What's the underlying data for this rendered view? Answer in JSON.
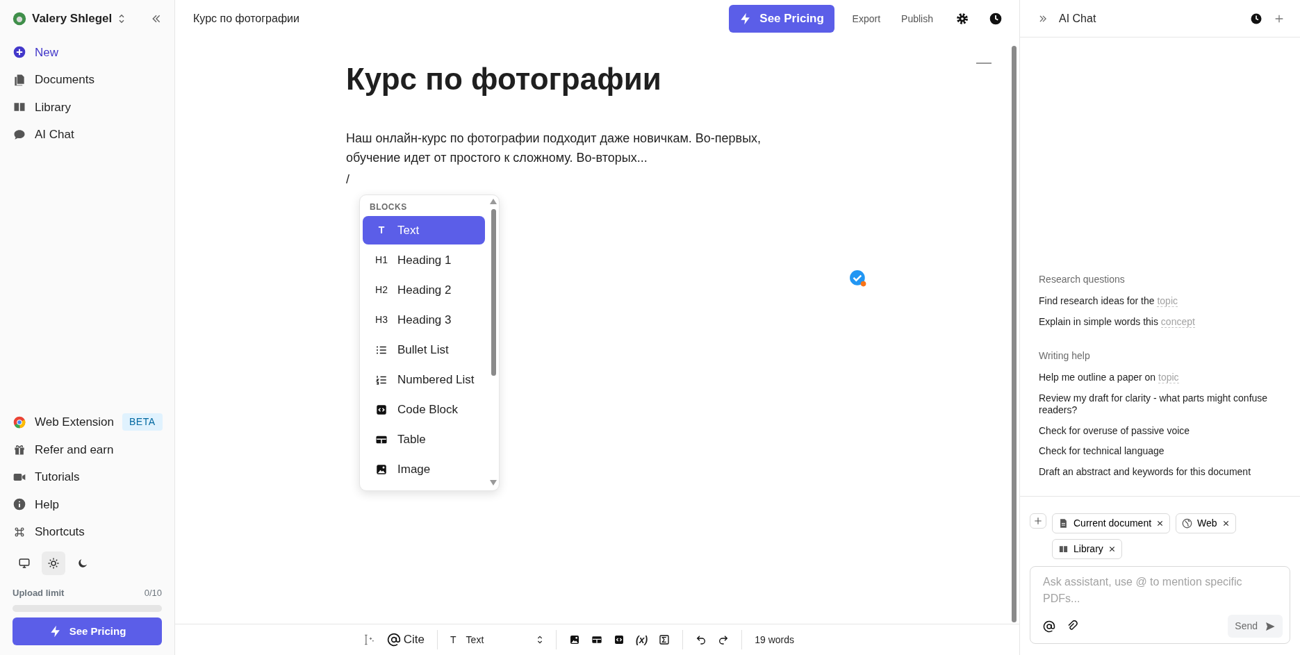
{
  "sidebar": {
    "user": {
      "name": "Valery Shlegel"
    },
    "nav": [
      {
        "kind": "new",
        "label": "New"
      },
      {
        "kind": "documents",
        "label": "Documents"
      },
      {
        "kind": "library",
        "label": "Library"
      },
      {
        "kind": "chat",
        "label": "AI Chat"
      }
    ],
    "bottom_nav": [
      {
        "kind": "extension",
        "label": "Web Extension",
        "badge": "BETA"
      },
      {
        "kind": "gift",
        "label": "Refer and earn"
      },
      {
        "kind": "video",
        "label": "Tutorials"
      },
      {
        "kind": "info",
        "label": "Help"
      },
      {
        "kind": "command",
        "label": "Shortcuts"
      }
    ],
    "themes": [
      {
        "kind": "system",
        "selected": false
      },
      {
        "kind": "light",
        "selected": true
      },
      {
        "kind": "dark",
        "selected": false
      }
    ],
    "upload": {
      "label": "Upload limit",
      "count": "0/10",
      "level": 0
    },
    "pricing_button": "See Pricing"
  },
  "topbar": {
    "doc_title": "Курс по фотографии",
    "pricing_button": "See Pricing",
    "actions": [
      "Export",
      "Publish"
    ]
  },
  "editor": {
    "title": "Курс по фотографии",
    "paragraph": "Наш онлайн-курс по фотографии подходит даже новичкам. Во-первых, обучение идет от простого к сложному. Во-вторых...",
    "slash": "/",
    "menu": {
      "heading": "BLOCKS",
      "items": [
        {
          "kind": "glyph",
          "glyph": "T",
          "label": "Text",
          "selected": true
        },
        {
          "kind": "glyph",
          "glyph": "H1",
          "label": "Heading 1",
          "selected": false
        },
        {
          "kind": "glyph",
          "glyph": "H2",
          "label": "Heading 2",
          "selected": false
        },
        {
          "kind": "glyph",
          "glyph": "H3",
          "label": "Heading 3",
          "selected": false
        },
        {
          "kind": "bullet",
          "label": "Bullet List",
          "selected": false
        },
        {
          "kind": "numbered",
          "label": "Numbered List",
          "selected": false
        },
        {
          "kind": "code",
          "label": "Code Block",
          "selected": false
        },
        {
          "kind": "table",
          "label": "Table",
          "selected": false
        },
        {
          "kind": "image",
          "label": "Image",
          "selected": false
        }
      ]
    }
  },
  "toolbar": {
    "cite": "Cite",
    "block_glyph": "T",
    "block_type": "Text",
    "variable_glyph": "(x)",
    "word_count": "19 words"
  },
  "chat": {
    "title": "AI Chat",
    "sections": [
      {
        "title": "Research questions",
        "prompts": [
          {
            "text": "Find research ideas for the",
            "variable": "topic"
          },
          {
            "text": "Explain in simple words this",
            "variable": "concept"
          }
        ]
      },
      {
        "title": "Writing help",
        "prompts": [
          {
            "text": "Help me outline a paper on",
            "variable": "topic"
          },
          {
            "text": "Review my draft for clarity - what parts might confuse readers?"
          },
          {
            "text": "Check for overuse of passive voice"
          },
          {
            "text": "Check for technical language"
          },
          {
            "text": "Draft an abstract and keywords for this document"
          }
        ]
      }
    ],
    "sources": [
      {
        "kind": "document",
        "label": "Current document"
      },
      {
        "kind": "web",
        "label": "Web"
      },
      {
        "kind": "library",
        "label": "Library"
      }
    ],
    "input": {
      "placeholder": "Ask assistant, use @ to mention specific PDFs..."
    },
    "send": "Send"
  }
}
